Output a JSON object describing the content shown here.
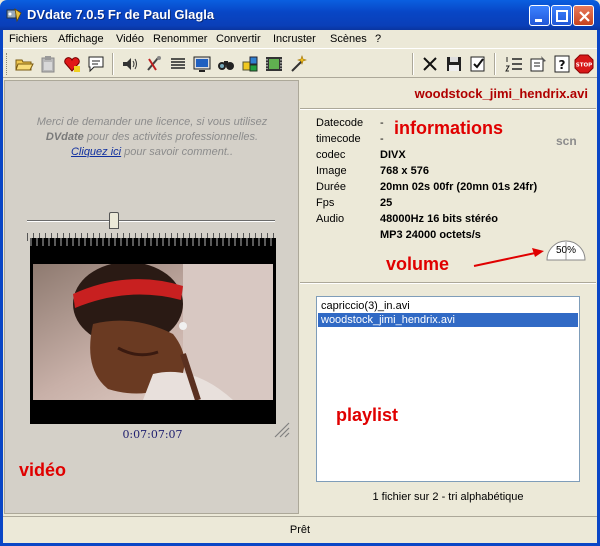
{
  "window": {
    "title": "DVdate 7.0.5 Fr de Paul Glagla"
  },
  "menu": [
    "Fichiers",
    "Affichage",
    "Vidéo",
    "Renommer",
    "Convertir",
    "Incruster",
    "Scènes",
    "?"
  ],
  "toolbar": {
    "left": [
      "open-folder-icon",
      "clipboard-icon",
      "favorite-heart-icon",
      "comment-bubble-icon",
      "speaker-icon",
      "tools-icon",
      "list-lines-icon",
      "monitor-icon",
      "search-binoculars-icon",
      "puzzle-icon",
      "film-strip-icon",
      "magic-wand-icon"
    ],
    "right": [
      "close-x-icon",
      "save-disk-icon",
      "check-list-icon",
      "numbered-list-icon",
      "settings-card-icon",
      "help-icon",
      "stop-icon"
    ],
    "stop_label": "STOP"
  },
  "license": {
    "line1": "Merci de demander une licence, si vous utilisez",
    "app_name": "DVdate",
    "line2_rest": " pour des activités professionnelles.",
    "link": "Cliquez ici",
    "line3_rest": " pour savoir comment.."
  },
  "video": {
    "seek_position": 0.35,
    "timecode": "0:07:07:07",
    "annotation": "vidéo"
  },
  "file": {
    "name": "woodstock_jimi_hendrix.avi"
  },
  "info": {
    "annotation": "informations",
    "scn": "scn",
    "rows": [
      {
        "key": "Datecode",
        "value": "-"
      },
      {
        "key": "timecode",
        "value": "-"
      },
      {
        "key": "codec",
        "value": "DIVX"
      },
      {
        "key": "Image",
        "value": "768 x 576"
      },
      {
        "key": "Durée",
        "value": "20mn 02s 00fr (20mn 01s 24fr)"
      },
      {
        "key": "Fps",
        "value": "25"
      },
      {
        "key": "Audio",
        "value": "48000Hz 16 bits  stéréo"
      },
      {
        "key": "",
        "value": "MP3 24000 octets/s"
      }
    ]
  },
  "volume": {
    "annotation": "volume",
    "level_text": "50%",
    "level": 0.5
  },
  "playlist": {
    "annotation": "playlist",
    "items": [
      {
        "name": "capriccio(3)_in.avi",
        "selected": false
      },
      {
        "name": "woodstock_jimi_hendrix.avi",
        "selected": true
      }
    ],
    "status": "1 fichier sur 2 - tri alphabétique"
  },
  "status": {
    "text": "Prêt"
  },
  "colors": {
    "annotation_red": "#e00000",
    "filename_red": "#b00000",
    "selection_blue": "#316ac5",
    "title_blue": "#0a46c6"
  }
}
